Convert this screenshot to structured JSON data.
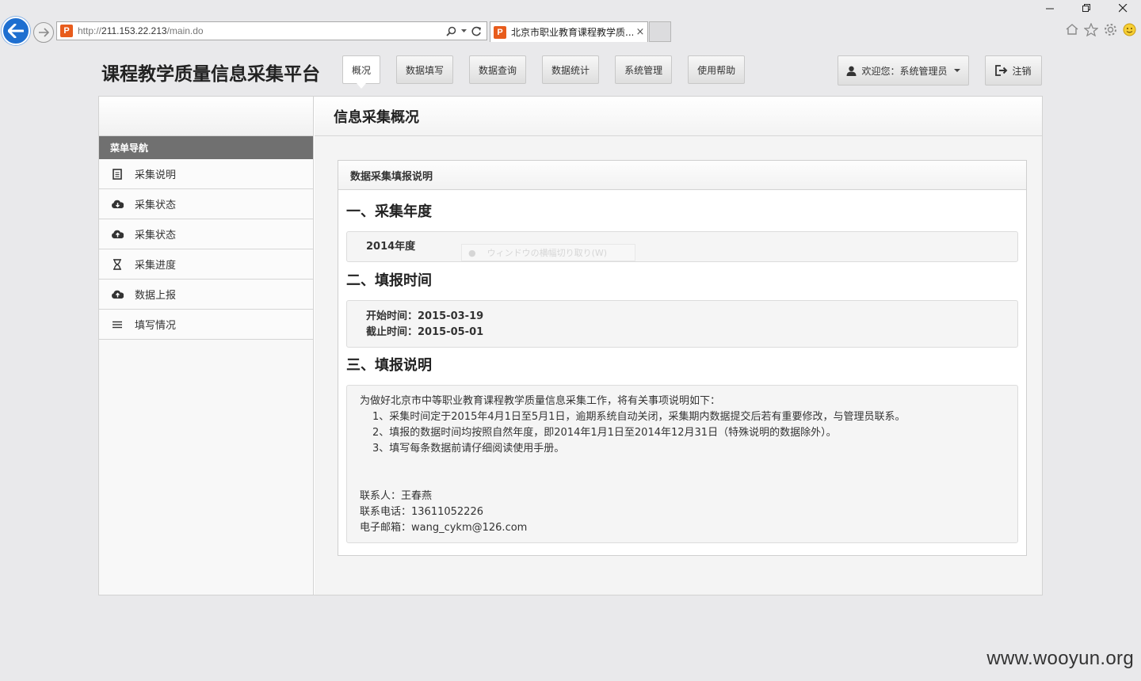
{
  "browser": {
    "url_prefix": "http://",
    "url_host": "211.153.22.213",
    "url_path": "/main.do",
    "tab_title": "北京市职业教育课程教学质...",
    "tab_close": "×"
  },
  "header": {
    "site_title": "课程教学质量信息采集平台",
    "nav": [
      "概况",
      "数据填写",
      "数据查询",
      "数据统计",
      "系统管理",
      "使用帮助"
    ],
    "user_label": "欢迎您：系统管理员",
    "logout_label": "注销"
  },
  "sidebar": {
    "heading": "菜单导航",
    "items": [
      {
        "label": "采集说明",
        "icon": "document-icon"
      },
      {
        "label": "采集状态",
        "icon": "cloud-download-icon"
      },
      {
        "label": "采集状态",
        "icon": "cloud-upload-icon"
      },
      {
        "label": "采集进度",
        "icon": "hourglass-icon"
      },
      {
        "label": "数据上报",
        "icon": "cloud-upload-icon"
      },
      {
        "label": "填写情况",
        "icon": "list-icon"
      }
    ]
  },
  "main": {
    "page_title": "信息采集概况",
    "panel_title": "数据采集填报说明",
    "section1_title": "一、采集年度",
    "year": "2014年度",
    "ime_hint": "ウィンドウの横幅切り取り(W)",
    "section2_title": "二、填报时间",
    "start_time": "开始时间：2015-03-19",
    "end_time": "截止时间：2015-05-01",
    "section3_title": "三、填报说明",
    "notes": {
      "intro": "为做好北京市中等职业教育课程教学质量信息采集工作，将有关事项说明如下：",
      "item1": "1、采集时间定于2015年4月1日至5月1日，逾期系统自动关闭，采集期内数据提交后若有重要修改，与管理员联系。",
      "item2": "2、填报的数据时间均按照自然年度，即2014年1月1日至2014年12月31日（特殊说明的数据除外）。",
      "item3": "3、填写每条数据前请仔细阅读使用手册。",
      "contact_person": "联系人：王春燕",
      "contact_phone": "联系电话：13611052226",
      "contact_email": "电子邮箱：wang_cykm@126.com"
    }
  },
  "watermark": "www.wooyun.org",
  "colors": {
    "menu_heading_bg": "#707070",
    "back_button": "#1e6fd0",
    "favicon": "#e85c1c"
  }
}
